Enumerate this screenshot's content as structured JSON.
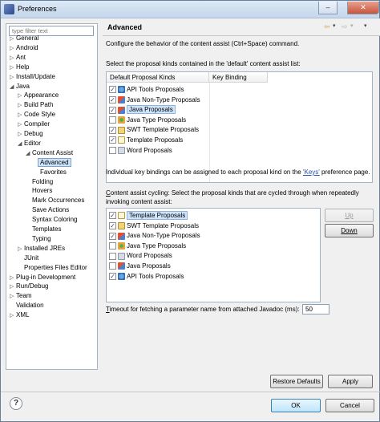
{
  "window": {
    "title": "Preferences",
    "min_label": "–",
    "max_label": "□",
    "close_label": "✕"
  },
  "filter": {
    "placeholder": "type filter text"
  },
  "tree": [
    {
      "label": "General",
      "twisty": "▷"
    },
    {
      "label": "Android",
      "twisty": "▷"
    },
    {
      "label": "Ant",
      "twisty": "▷"
    },
    {
      "label": "Help",
      "twisty": "▷"
    },
    {
      "label": "Install/Update",
      "twisty": "▷"
    },
    {
      "label": "Java",
      "twisty": "◢"
    },
    {
      "label": "Appearance",
      "twisty": "▷"
    },
    {
      "label": "Build Path",
      "twisty": "▷"
    },
    {
      "label": "Code Style",
      "twisty": "▷"
    },
    {
      "label": "Compiler",
      "twisty": "▷"
    },
    {
      "label": "Debug",
      "twisty": "▷"
    },
    {
      "label": "Editor",
      "twisty": "◢"
    },
    {
      "label": "Content Assist",
      "twisty": "◢"
    },
    {
      "label": "Advanced",
      "twisty": ""
    },
    {
      "label": "Favorites",
      "twisty": ""
    },
    {
      "label": "Folding",
      "twisty": ""
    },
    {
      "label": "Hovers",
      "twisty": ""
    },
    {
      "label": "Mark Occurrences",
      "twisty": ""
    },
    {
      "label": "Save Actions",
      "twisty": ""
    },
    {
      "label": "Syntax Coloring",
      "twisty": ""
    },
    {
      "label": "Templates",
      "twisty": ""
    },
    {
      "label": "Typing",
      "twisty": ""
    },
    {
      "label": "Installed JREs",
      "twisty": "▷"
    },
    {
      "label": "JUnit",
      "twisty": ""
    },
    {
      "label": "Properties Files Editor",
      "twisty": ""
    },
    {
      "label": "Plug-in Development",
      "twisty": "▷"
    },
    {
      "label": "Run/Debug",
      "twisty": "▷"
    },
    {
      "label": "Team",
      "twisty": "▷"
    },
    {
      "label": "Validation",
      "twisty": ""
    },
    {
      "label": "XML",
      "twisty": "▷"
    }
  ],
  "page": {
    "title": "Advanced",
    "nav_back": "⇦",
    "nav_fwd": "⇨",
    "nav_dd": "▾",
    "menu_dd": "▾",
    "description": "Configure the behavior of the content assist (Ctrl+Space) command.",
    "default_list_label": "Select the proposal kinds contained in the 'default' content assist list:",
    "col_kinds": "Default Proposal Kinds",
    "col_binding": "Key Binding",
    "default_list": [
      {
        "label": "API Tools Proposals",
        "checked": "✓",
        "icon": "api"
      },
      {
        "label": "Java Non-Type Proposals",
        "checked": "✓",
        "icon": "java"
      },
      {
        "label": "Java Proposals",
        "checked": "✓",
        "icon": "java"
      },
      {
        "label": "Java Type Proposals",
        "checked": "",
        "icon": "jtype"
      },
      {
        "label": "SWT Template Proposals",
        "checked": "✓",
        "icon": "swt"
      },
      {
        "label": "Template Proposals",
        "checked": "✓",
        "icon": "tpl"
      },
      {
        "label": "Word Proposals",
        "checked": "",
        "icon": "word"
      }
    ],
    "keys_text_pre": "Individual key bindings can be assigned to each proposal kind on the ",
    "keys_link": "'Keys'",
    "keys_text_post": " preference page.",
    "cycling_line1_u": "C",
    "cycling_line1": "ontent assist cycling: Select the proposal kinds that are cycled through when repeatedly",
    "cycling_line2": "invoking content assist:",
    "cycling_list": [
      {
        "label": "Template Proposals",
        "checked": "✓",
        "icon": "tpl"
      },
      {
        "label": "SWT Template Proposals",
        "checked": "✓",
        "icon": "swt"
      },
      {
        "label": "Java Non-Type Proposals",
        "checked": "✓",
        "icon": "java"
      },
      {
        "label": "Java Type Proposals",
        "checked": "",
        "icon": "jtype"
      },
      {
        "label": "Word Proposals",
        "checked": "",
        "icon": "word"
      },
      {
        "label": "Java Proposals",
        "checked": "",
        "icon": "java"
      },
      {
        "label": "API Tools Proposals",
        "checked": "✓",
        "icon": "api"
      }
    ],
    "up_label": "Up",
    "down_label": "Down",
    "timeout_u": "T",
    "timeout_label": "imeout for fetching a parameter name from attached Javadoc (ms):",
    "timeout_value": "50",
    "restore_label": "Restore Defaults",
    "apply_label": "Apply"
  },
  "footer": {
    "help_label": "?",
    "ok_label": "OK",
    "cancel_label": "Cancel"
  }
}
